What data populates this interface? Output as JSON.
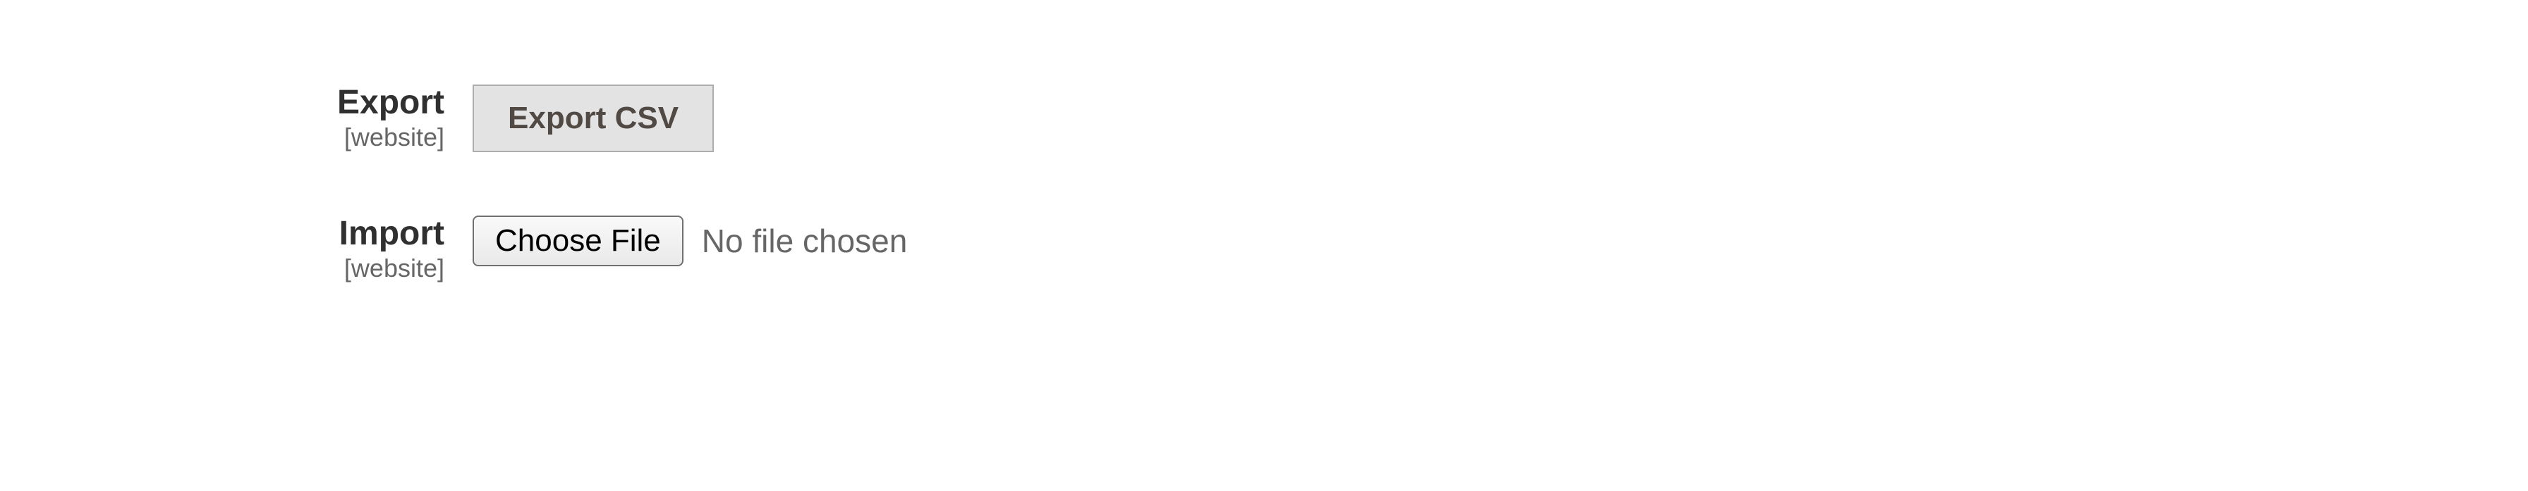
{
  "export": {
    "label": "Export",
    "scope": "[website]",
    "button": "Export CSV"
  },
  "import": {
    "label": "Import",
    "scope": "[website]",
    "choose_button": "Choose File",
    "status": "No file chosen"
  }
}
